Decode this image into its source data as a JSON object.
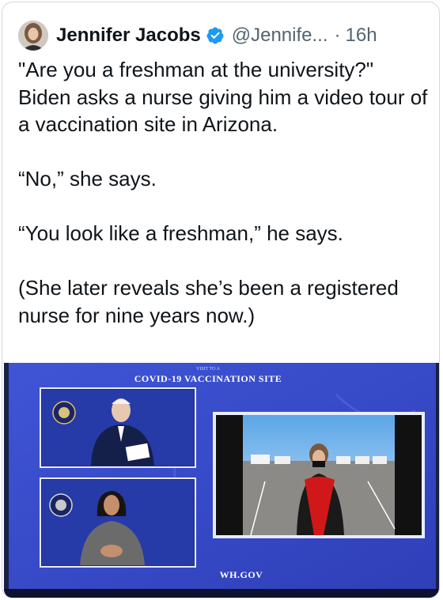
{
  "tweet": {
    "author_name": "Jennifer Jacobs",
    "handle": "@Jennife...",
    "separator": "·",
    "time": "16h",
    "paragraphs": [
      "\"Are you a freshman at the university?\" Biden asks a nurse giving him a video tour of a vaccination site in Arizona.",
      "“No,” she says.",
      "“You look like a freshman,” he says.",
      "(She later reveals she’s been a registered nurse for nine years now.)"
    ],
    "verified_icon": "verified-badge-icon"
  },
  "media": {
    "banner_small": "VISIT TO A",
    "banner_title": "COVID-19 VACCINATION SITE",
    "footer": "WH.GOV"
  },
  "colors": {
    "text": "#0f1419",
    "secondary": "#536471",
    "verified": "#1d9bf0",
    "screen_blue": "#3a49c9"
  }
}
